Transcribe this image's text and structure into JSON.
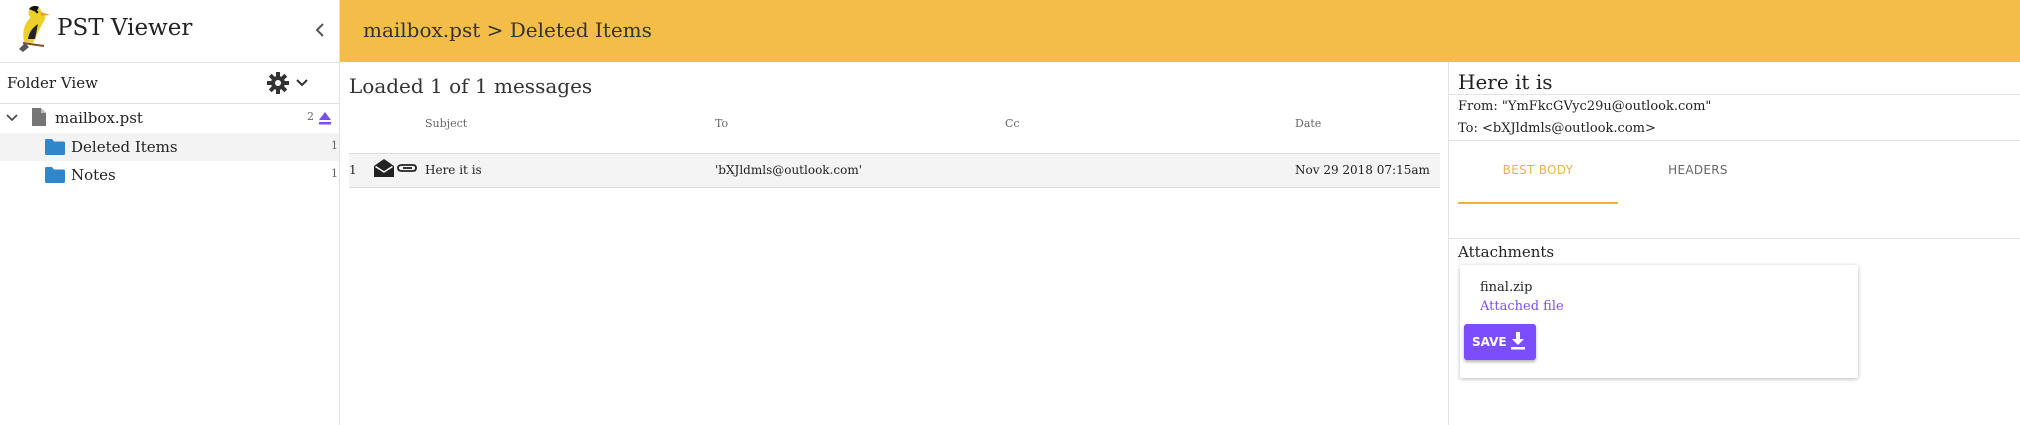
{
  "app": {
    "title": "PST Viewer"
  },
  "sidebar": {
    "folder_view_label": "Folder View",
    "tree": [
      {
        "label": "mailbox.pst",
        "count": "2",
        "type": "file"
      },
      {
        "label": "Deleted Items",
        "count": "1",
        "type": "folder",
        "selected": true
      },
      {
        "label": "Notes",
        "count": "1",
        "type": "folder"
      }
    ]
  },
  "header": {
    "breadcrumb": "mailbox.pst > Deleted Items"
  },
  "message_list": {
    "status": "Loaded 1 of 1 messages",
    "columns": [
      "Subject",
      "To",
      "Cc",
      "Date"
    ],
    "rows": [
      {
        "index": "1",
        "subject": "Here it is",
        "to": "'bXJldmls@outlook.com'",
        "cc": "",
        "date": "Nov 29 2018 07:15am"
      }
    ]
  },
  "preview": {
    "subject": "Here it is",
    "from": "From: \"YmFkcGVyc29u@outlook.com\"",
    "to": "To: <bXJldmls@outlook.com>",
    "tabs": [
      "BEST BODY",
      "HEADERS"
    ],
    "attachments_label": "Attachments",
    "attachment": {
      "name": "final.zip",
      "description": "Attached file",
      "save_label": "SAVE"
    }
  },
  "colors": {
    "accent": "#f3bd47",
    "tab_active": "#e9b444",
    "primary": "#7c4dff",
    "folder": "#2f86c9"
  }
}
